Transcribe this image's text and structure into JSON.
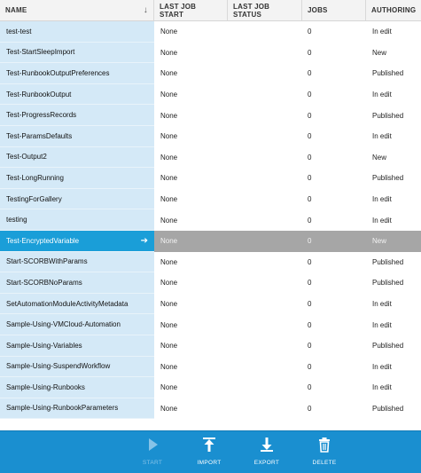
{
  "columns": [
    "NAME",
    "LAST JOB START",
    "LAST JOB STATUS",
    "JOBS",
    "AUTHORING"
  ],
  "sort_icon": "arrow-down-icon",
  "rows": [
    {
      "name": "test-test",
      "start": "None",
      "status": "",
      "jobs": "0",
      "authoring": "In edit"
    },
    {
      "name": "Test-StartSleepImport",
      "start": "None",
      "status": "",
      "jobs": "0",
      "authoring": "New"
    },
    {
      "name": "Test-RunbookOutputPreferences",
      "start": "None",
      "status": "",
      "jobs": "0",
      "authoring": "Published"
    },
    {
      "name": "Test-RunbookOutput",
      "start": "None",
      "status": "",
      "jobs": "0",
      "authoring": "In edit"
    },
    {
      "name": "Test-ProgressRecords",
      "start": "None",
      "status": "",
      "jobs": "0",
      "authoring": "Published"
    },
    {
      "name": "Test-ParamsDefaults",
      "start": "None",
      "status": "",
      "jobs": "0",
      "authoring": "In edit"
    },
    {
      "name": "Test-Output2",
      "start": "None",
      "status": "",
      "jobs": "0",
      "authoring": "New"
    },
    {
      "name": "Test-LongRunning",
      "start": "None",
      "status": "",
      "jobs": "0",
      "authoring": "Published"
    },
    {
      "name": "TestingForGallery",
      "start": "None",
      "status": "",
      "jobs": "0",
      "authoring": "In edit"
    },
    {
      "name": "testing",
      "start": "None",
      "status": "",
      "jobs": "0",
      "authoring": "In edit"
    },
    {
      "name": "Test-EncryptedVariable",
      "start": "None",
      "status": "",
      "jobs": "0",
      "authoring": "New",
      "selected": true
    },
    {
      "name": "Start-SCORBWithParams",
      "start": "None",
      "status": "",
      "jobs": "0",
      "authoring": "Published"
    },
    {
      "name": "Start-SCORBNoParams",
      "start": "None",
      "status": "",
      "jobs": "0",
      "authoring": "Published"
    },
    {
      "name": "SetAutomationModuleActivityMetadata",
      "start": "None",
      "status": "",
      "jobs": "0",
      "authoring": "In edit"
    },
    {
      "name": "Sample-Using-VMCloud-Automation",
      "start": "None",
      "status": "",
      "jobs": "0",
      "authoring": "In edit"
    },
    {
      "name": "Sample-Using-Variables",
      "start": "None",
      "status": "",
      "jobs": "0",
      "authoring": "Published"
    },
    {
      "name": "Sample-Using-SuspendWorkflow",
      "start": "None",
      "status": "",
      "jobs": "0",
      "authoring": "In edit"
    },
    {
      "name": "Sample-Using-Runbooks",
      "start": "None",
      "status": "",
      "jobs": "0",
      "authoring": "In edit"
    },
    {
      "name": "Sample-Using-RunbookParameters",
      "start": "None",
      "status": "",
      "jobs": "0",
      "authoring": "Published"
    }
  ],
  "toolbar": {
    "start": {
      "label": "START",
      "icon": "play-icon",
      "enabled": false
    },
    "import": {
      "label": "IMPORT",
      "icon": "import-icon",
      "enabled": true
    },
    "export": {
      "label": "EXPORT",
      "icon": "export-icon",
      "enabled": true
    },
    "delete": {
      "label": "DELETE",
      "icon": "trash-icon",
      "enabled": true
    }
  },
  "colors": {
    "name_cell_bg": "#d4e9f7",
    "selected_name_bg": "#1a9ed8",
    "selected_row_bg": "#a6a6a6",
    "toolbar_bg": "#1a8fd0"
  }
}
